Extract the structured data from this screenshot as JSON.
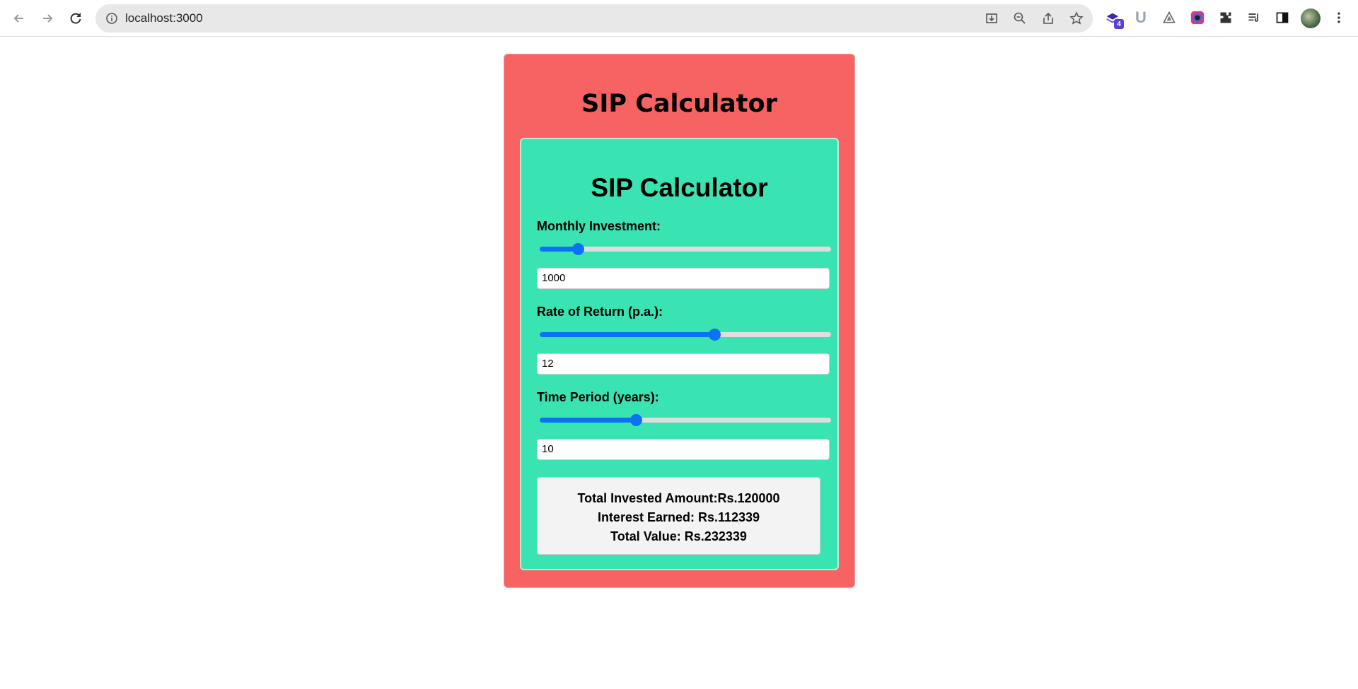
{
  "browser": {
    "url": "localhost:3000",
    "extension_badge": "4"
  },
  "outer": {
    "title": "SIP Calculator"
  },
  "calculator": {
    "title": "SIP Calculator",
    "monthly_investment": {
      "label": "Monthly Investment:",
      "value": "1000",
      "slider_fraction": 0.13
    },
    "rate_of_return": {
      "label": "Rate of Return (p.a.):",
      "value": "12",
      "slider_fraction": 0.6
    },
    "time_period": {
      "label": "Time Period (years):",
      "value": "10",
      "slider_fraction": 0.33
    },
    "results": {
      "total_invested": "Total Invested Amount:Rs.120000",
      "interest_earned": "Interest Earned: Rs.112339",
      "total_value": "Total Value: Rs.232339"
    }
  },
  "colors": {
    "outer_bg": "#f76262",
    "inner_bg": "#3ae3b2",
    "accent": "#0b72f3"
  }
}
